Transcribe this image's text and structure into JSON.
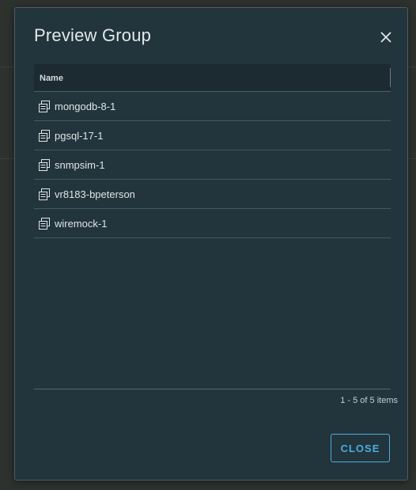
{
  "dialog": {
    "title": "Preview Group",
    "close_icon": "close-icon"
  },
  "grid": {
    "columns": [
      {
        "label": "Name"
      }
    ],
    "rows": [
      {
        "name": "mongodb-8-1",
        "icon": "vm-icon"
      },
      {
        "name": "pgsql-17-1",
        "icon": "vm-icon"
      },
      {
        "name": "snmpsim-1",
        "icon": "vm-icon"
      },
      {
        "name": "vr8183-bpeterson",
        "icon": "vm-icon"
      },
      {
        "name": "wiremock-1",
        "icon": "vm-icon"
      }
    ],
    "pagination": "1 - 5 of 5 items"
  },
  "footer": {
    "close_label": "CLOSE"
  },
  "colors": {
    "dialog_bg": "#22343c",
    "header_bg": "#1c2a31",
    "accent": "#49aee0",
    "text": "#dfe5e8"
  }
}
